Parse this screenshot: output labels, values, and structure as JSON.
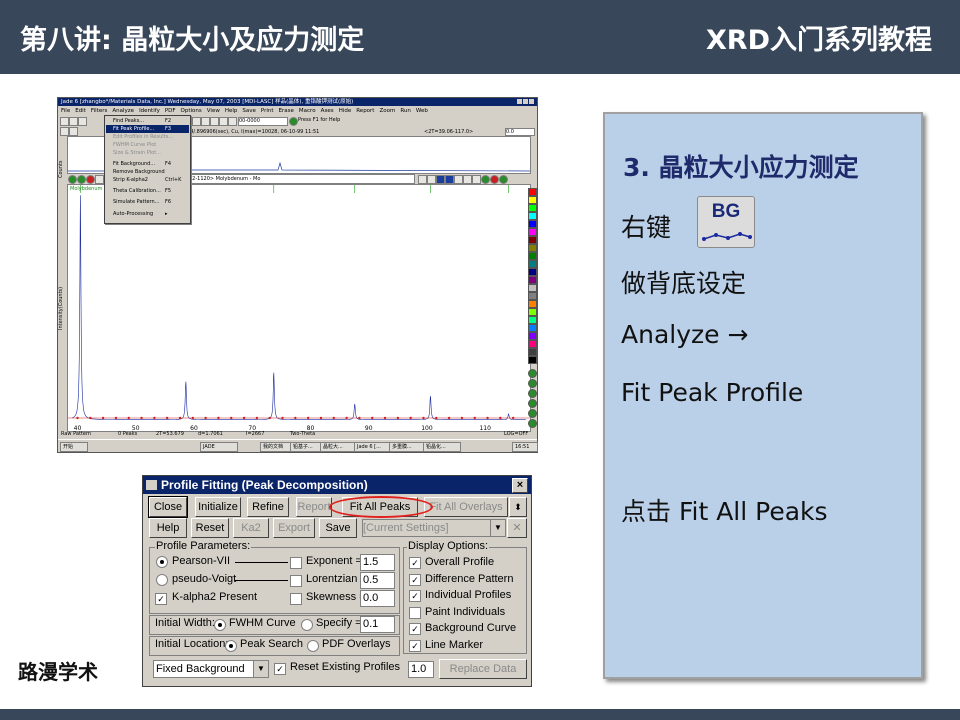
{
  "header": {
    "title": "第八讲: 晶粒大小及应力测定",
    "series": "XRD入门系列教程"
  },
  "footer": {
    "brand": "路漫学术"
  },
  "jade": {
    "title": "Jade 6 [zhangbo*/Materials Data, Inc.] Wednesday, May 07, 2003 [MDI-LASC] 样品(晶体), 重铬酸钾测试(原始)",
    "menus": [
      "File",
      "Edit",
      "Filters",
      "Analyze",
      "Identify",
      "PDF",
      "Options",
      "View",
      "Help",
      "Save",
      "Print",
      "Erase",
      "Macro",
      "Axes",
      "Hide",
      "Report",
      "Zoom",
      "Run",
      "Web"
    ],
    "scan_info": "SCAN: 39.06/117.0/0.004/.896906(sec), Cu, I(max)=10028, 06-10-99 11:51",
    "range_info": "<2T=39.06-117.0>",
    "hint": "Press F1 for Help",
    "step_value": "00-0000",
    "phase": "42-1120> Molybdenum - Mo",
    "phase_short": "Molybdenum - Mo",
    "counts_label": "Counts",
    "ylabel": "Intensity(Counts)",
    "dropdown_items": [
      {
        "label": "Find Peaks...",
        "key": "F2",
        "state": "normal"
      },
      {
        "label": "Fit Peak Profile...",
        "key": "F3",
        "state": "highlighted"
      },
      {
        "label": "Edit Profiles in Results...",
        "key": "",
        "state": "disabled"
      },
      {
        "label": "FWHM Curve Plot",
        "key": "",
        "state": "disabled"
      },
      {
        "label": "Size & Strain Plot...",
        "key": "",
        "state": "disabled"
      },
      {
        "label": "Fit Background...",
        "key": "F4",
        "state": "normal"
      },
      {
        "label": "Remove Background",
        "key": "",
        "state": "normal"
      },
      {
        "label": "Strip K-alpha2",
        "key": "Ctrl+K",
        "state": "normal"
      },
      {
        "label": "Theta Calibration...",
        "key": "F5",
        "state": "normal"
      },
      {
        "label": "Simulate Pattern...",
        "key": "F6",
        "state": "normal"
      },
      {
        "label": "Auto-Processing",
        "key": "▸",
        "state": "normal"
      }
    ],
    "x_ticks": [
      "40",
      "50",
      "60",
      "70",
      "80",
      "90",
      "100",
      "110"
    ],
    "status": [
      "Raw Pattern",
      "0 Peaks",
      "2T=53.679",
      "d=1.7061",
      "I=2667",
      "Two-Theta",
      "LOG=OFF"
    ],
    "taskbar": [
      "开始",
      "JADE",
      "我的文档",
      "铅基子...",
      "晶粒大...",
      "Jade 6 [...",
      "多重膜...",
      "铅晶化...",
      "16:51"
    ]
  },
  "profile_fitting": {
    "title": "Profile Fitting (Peak Decomposition)",
    "buttons": {
      "close": "Close",
      "initialize": "Initialize",
      "refine": "Refine",
      "report": "Report",
      "fit_all_peaks": "Fit All Peaks",
      "fit_all_overlays": "Fit All Overlays",
      "help": "Help",
      "reset": "Reset",
      "ka2": "Ka2",
      "export": "Export",
      "save": "Save",
      "replace_data": "Replace Data"
    },
    "settings_combo": "[Current Settings]",
    "profile_params_label": "Profile Parameters:",
    "pearson": "Pearson-VII",
    "pseudo_voigt": "pseudo-Voigt",
    "kalpha2": "K-alpha2 Present",
    "exponent_label": "Exponent =",
    "exponent_value": "1.5",
    "lorentzian_label": "Lorentzian =",
    "lorentzian_value": "0.5",
    "skewness_label": "Skewness =",
    "skewness_value": "0.0",
    "initial_width_label": "Initial Width:",
    "fwhm_curve": "FWHM Curve",
    "specify_label": "Specify =",
    "specify_value": "0.1",
    "initial_location_label": "Initial Location:",
    "peak_search": "Peak Search",
    "pdf_overlays": "PDF Overlays",
    "background_combo": "Fixed Background",
    "reset_existing": "Reset Existing Profiles",
    "display_options_label": "Display Options:",
    "display_options": [
      "Overall Profile",
      "Difference Pattern",
      "Individual Profiles",
      "Paint Individuals",
      "Background Curve",
      "Line Marker"
    ],
    "display_checked": [
      true,
      true,
      true,
      false,
      true,
      true
    ],
    "value_box": "1.0"
  },
  "panel": {
    "heading": "3. 晶粒大小应力测定",
    "right_click": "右键",
    "bg_icon_label": "BG",
    "line2": "做背底设定",
    "line3": "Analyze →",
    "line4": "Fit Peak Profile",
    "line5": "点击 Fit All Peaks"
  },
  "chart_data": {
    "type": "line",
    "x_range": [
      39.06,
      117.0
    ],
    "ylabel": "Intensity(Counts)",
    "x_ticks": [
      40,
      50,
      60,
      70,
      80,
      90,
      100,
      110
    ],
    "series": [
      {
        "name": "",
        "x": [
          40.5,
          58.6,
          73.7,
          87.6,
          100.6,
          114.0
        ],
        "y": [
          10028,
          1700,
          2100,
          700,
          1050,
          250
        ]
      }
    ]
  }
}
